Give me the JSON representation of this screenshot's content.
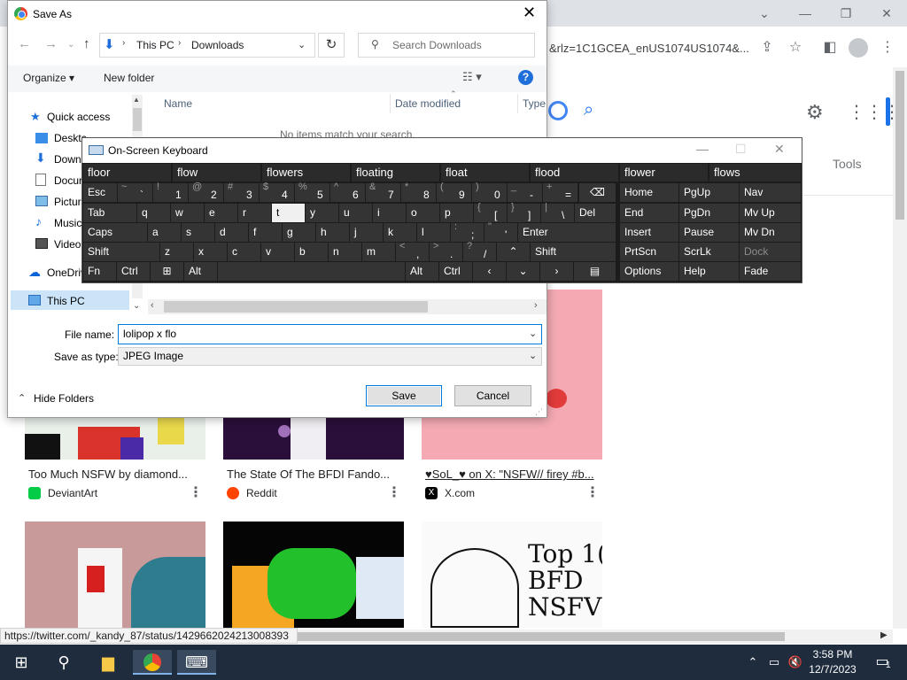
{
  "browser": {
    "url_fragment": "&rlz=1C1GCEA_enUS1074US1074&...",
    "tools_label": "Tools",
    "status_url": "https://twitter.com/_kandy_87/status/1429662024213008393"
  },
  "results": [
    {
      "title": "Too Much NSFW by diamond...",
      "source": "DeviantArt",
      "source_color": "#05cc47"
    },
    {
      "title": "The State Of The BFDI Fando...",
      "source": "Reddit",
      "source_color": "#ff4500"
    },
    {
      "title": "♥SoL_♥ on X: \"NSFW// firey #b...",
      "source": "X.com",
      "source_color": "#000000"
    }
  ],
  "bottom_thumb_text": "Top 1(\nBFD\nNSFV",
  "taskbar": {
    "time": "3:58 PM",
    "date": "12/7/2023",
    "notification_count": "1"
  },
  "save_dialog": {
    "title": "Save As",
    "breadcrumb": [
      "This PC",
      "Downloads"
    ],
    "search_placeholder": "Search Downloads",
    "organize_label": "Organize",
    "new_folder_label": "New folder",
    "col_name": "Name",
    "col_date": "Date modified",
    "col_type": "Type",
    "empty_message": "No items match your search.",
    "nav_items": [
      "Quick access",
      "Desktop",
      "Downloads",
      "Documents",
      "Pictures",
      "Music",
      "Videos",
      "OneDrive",
      "This PC"
    ],
    "nav_visible": [
      "Quick access",
      "Desktc",
      "Down",
      "Docur",
      "Pictur",
      "Music",
      "Video:",
      "OneDriv",
      "This PC"
    ],
    "file_name_label": "File name:",
    "file_name_value": "lolipop x flo",
    "save_type_label": "Save as type:",
    "save_type_value": "JPEG Image",
    "hide_folders_label": "Hide Folders",
    "save_label": "Save",
    "cancel_label": "Cancel"
  },
  "keyboard": {
    "title": "On-Screen Keyboard",
    "predictions": [
      "floor",
      "flow",
      "flowers",
      "floating",
      "float",
      "flood",
      "flower",
      "flows"
    ],
    "row1": [
      "Esc",
      "~ `",
      "! 1",
      "@ 2",
      "# 3",
      "$ 4",
      "% 5",
      "^ 6",
      "& 7",
      "* 8",
      "( 9",
      ") 0",
      "_ -",
      "+ ="
    ],
    "row2": [
      "Tab",
      "q",
      "w",
      "e",
      "r",
      "t",
      "y",
      "u",
      "i",
      "o",
      "p",
      "{ [",
      "} ]",
      "| \\",
      "Del"
    ],
    "row3": [
      "Caps",
      "a",
      "s",
      "d",
      "f",
      "g",
      "h",
      "j",
      "k",
      "l",
      ": ;",
      "\" '",
      "Enter"
    ],
    "row4": [
      "Shift",
      "z",
      "x",
      "c",
      "v",
      "b",
      "n",
      "m",
      "< ,",
      "> .",
      "? /",
      "Shift"
    ],
    "row5": [
      "Fn",
      "Ctrl",
      "Alt",
      "Alt",
      "Ctrl"
    ],
    "nav_keys": [
      "Home",
      "PgUp",
      "Nav",
      "End",
      "PgDn",
      "Mv Up",
      "Insert",
      "Pause",
      "Mv Dn",
      "PrtScn",
      "ScrLk",
      "Dock",
      "Options",
      "Help",
      "Fade"
    ]
  }
}
